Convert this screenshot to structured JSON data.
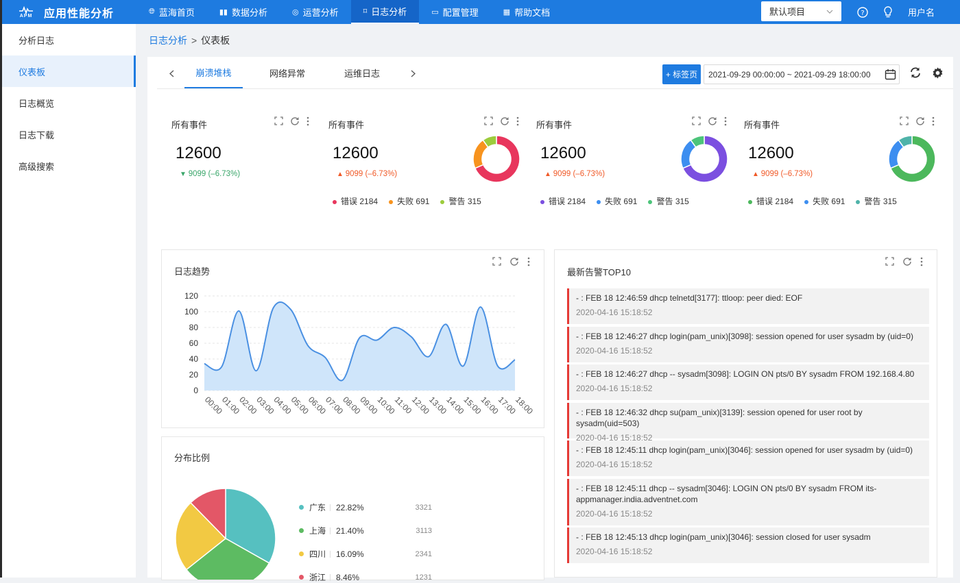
{
  "app": {
    "logo_small": "APM",
    "title": "应用性能分析"
  },
  "nav": [
    {
      "icon": "globe-icon",
      "label": "蓝海首页"
    },
    {
      "icon": "bar-chart-icon",
      "label": "数据分析"
    },
    {
      "icon": "ops-icon",
      "label": "运营分析"
    },
    {
      "icon": "bookmark-icon",
      "label": "日志分析",
      "active": true
    },
    {
      "icon": "monitor-icon",
      "label": "配置管理"
    },
    {
      "icon": "grid-icon",
      "label": "帮助文档"
    }
  ],
  "project_select": {
    "value": "默认项目"
  },
  "user": {
    "name": "用户名"
  },
  "sidebar": [
    {
      "label": "分析日志"
    },
    {
      "label": "仪表板",
      "active": true
    },
    {
      "label": "日志概览"
    },
    {
      "label": "日志下载"
    },
    {
      "label": "高级搜索"
    }
  ],
  "breadcrumb": {
    "parent": "日志分析",
    "separator": ">",
    "current": "仪表板"
  },
  "tabs": [
    "崩溃堆栈",
    "网络异常",
    "运维日志"
  ],
  "toolbar": {
    "add_tab": "+ 标签页",
    "date_range": "2021-09-29 00:00:00 ~ 2021-09-29 18:00:00"
  },
  "stats": [
    {
      "title": "所有事件",
      "value": "12600",
      "delta": "9099 (–6.73%)",
      "trend": "down",
      "legend": []
    },
    {
      "title": "所有事件",
      "value": "12600",
      "delta": "9099 (–6.73%)",
      "trend": "up",
      "legend": [
        {
          "name": "错误",
          "value": "2184",
          "color": "#e8365d"
        },
        {
          "name": "失败",
          "value": "691",
          "color": "#f7931e"
        },
        {
          "name": "警告",
          "value": "315",
          "color": "#9ccc3c"
        }
      ],
      "donut": [
        {
          "value": 2184,
          "color": "#e8365d"
        },
        {
          "value": 691,
          "color": "#f7931e"
        },
        {
          "value": 315,
          "color": "#9ccc3c"
        }
      ]
    },
    {
      "title": "所有事件",
      "value": "12600",
      "delta": "9099 (–6.73%)",
      "trend": "up",
      "legend": [
        {
          "name": "错误",
          "value": "2184",
          "color": "#7b4fe0"
        },
        {
          "name": "失败",
          "value": "691",
          "color": "#3d8ef0"
        },
        {
          "name": "警告",
          "value": "315",
          "color": "#4cc47a"
        }
      ],
      "donut": [
        {
          "value": 2184,
          "color": "#7b4fe0"
        },
        {
          "value": 691,
          "color": "#3d8ef0"
        },
        {
          "value": 315,
          "color": "#4cc47a"
        }
      ]
    },
    {
      "title": "所有事件",
      "value": "12600",
      "delta": "9099 (–6.73%)",
      "trend": "up",
      "legend": [
        {
          "name": "错误",
          "value": "2184",
          "color": "#4cb85c"
        },
        {
          "name": "失败",
          "value": "691",
          "color": "#3d8ef0"
        },
        {
          "name": "警告",
          "value": "315",
          "color": "#4fb3a9"
        }
      ],
      "donut": [
        {
          "value": 2184,
          "color": "#4cb85c"
        },
        {
          "value": 691,
          "color": "#3d8ef0"
        },
        {
          "value": 315,
          "color": "#4fb3a9"
        }
      ]
    }
  ],
  "trend_card": {
    "title": "日志趋势"
  },
  "chart_data": [
    {
      "type": "area",
      "title": "日志趋势",
      "x": [
        "00:00",
        "01:00",
        "02:00",
        "03:00",
        "04:00",
        "05:00",
        "06:00",
        "07:00",
        "08:00",
        "09:00",
        "10:00",
        "11:00",
        "12:00",
        "13:00",
        "14:00",
        "15:00",
        "16:00",
        "17:00",
        "18:00"
      ],
      "values": [
        34,
        30,
        101,
        25,
        105,
        103,
        57,
        42,
        13,
        67,
        64,
        80,
        68,
        43,
        84,
        31,
        106,
        31,
        39
      ],
      "ylim": [
        0,
        120
      ],
      "yticks": [
        0,
        20,
        40,
        60,
        80,
        100,
        120
      ],
      "color": "#4a90e2",
      "fill": "#cfe5fa"
    },
    {
      "type": "pie",
      "title": "分布比例",
      "slices": [
        {
          "name": "广东",
          "pct": "22.82%",
          "count": "3321",
          "value": 3321,
          "color": "#56c0c0"
        },
        {
          "name": "上海",
          "pct": "21.40%",
          "count": "3113",
          "value": 3113,
          "color": "#5dbb62"
        },
        {
          "name": "四川",
          "pct": "16.09%",
          "count": "2341",
          "value": 2341,
          "color": "#f2c943"
        },
        {
          "name": "浙江",
          "pct": "8.46%",
          "count": "1231",
          "value": 1231,
          "color": "#e35767"
        }
      ]
    }
  ],
  "alerts_card": {
    "title": "最新告警TOP10"
  },
  "alerts": [
    {
      "msg": "- : FEB 18 12:46:59 dhcp telnetd[3177]: ttloop: peer died: EOF",
      "time": "2020-04-16 15:18:52"
    },
    {
      "msg": "- : FEB 18 12:46:27 dhcp login(pam_unix)[3098]: session opened for user sysadm by (uid=0)",
      "time": "2020-04-16 15:18:52"
    },
    {
      "msg": "- : FEB 18 12:46:27 dhcp -- sysadm[3098]: LOGIN ON pts/0 BY sysadm FROM 192.168.4.80",
      "time": "2020-04-16 15:18:52"
    },
    {
      "msg": "- : FEB 18 12:46:32 dhcp su(pam_unix)[3139]: session opened for user root by sysadm(uid=503)",
      "time": "2020-04-16 15:18:52"
    },
    {
      "msg": "- : FEB 18 12:45:11 dhcp login(pam_unix)[3046]: session opened for user sysadm by (uid=0)",
      "time": "2020-04-16 15:18:52"
    },
    {
      "msg": "- : FEB 18 12:45:11 dhcp -- sysadm[3046]: LOGIN ON pts/0 BY sysadm FROM its-appmanager.india.adventnet.com",
      "time": "2020-04-16 15:18:52"
    },
    {
      "msg": "- : FEB 18 12:45:13 dhcp login(pam_unix)[3046]: session closed for user sysadm",
      "time": "2020-04-16 15:18:52"
    }
  ],
  "pie_card": {
    "title": "分布比例"
  }
}
